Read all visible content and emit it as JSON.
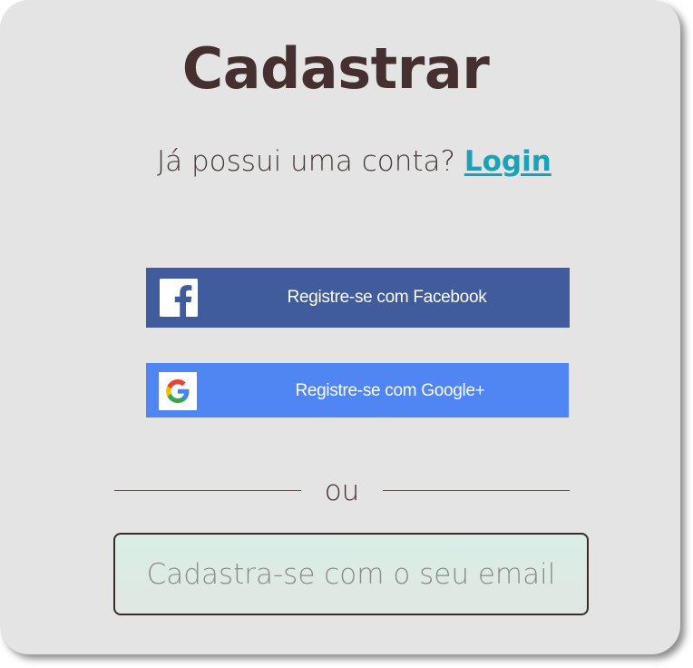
{
  "header": {
    "title": "Cadastrar",
    "question": "Já possui uma conta?",
    "login_label": "Login"
  },
  "social": {
    "facebook_label": "Registre-se com Facebook",
    "facebook_icon": "facebook-icon",
    "facebook_color": "#405c9d",
    "google_label": "Registre-se com Google+",
    "google_icon": "google-icon",
    "google_color": "#5086f4"
  },
  "divider": {
    "text": "ou"
  },
  "email": {
    "label": "Cadastra-se com o seu email"
  },
  "colors": {
    "card_bg": "#e4e4e4",
    "title": "#46302f",
    "link": "#1aa2b8"
  }
}
